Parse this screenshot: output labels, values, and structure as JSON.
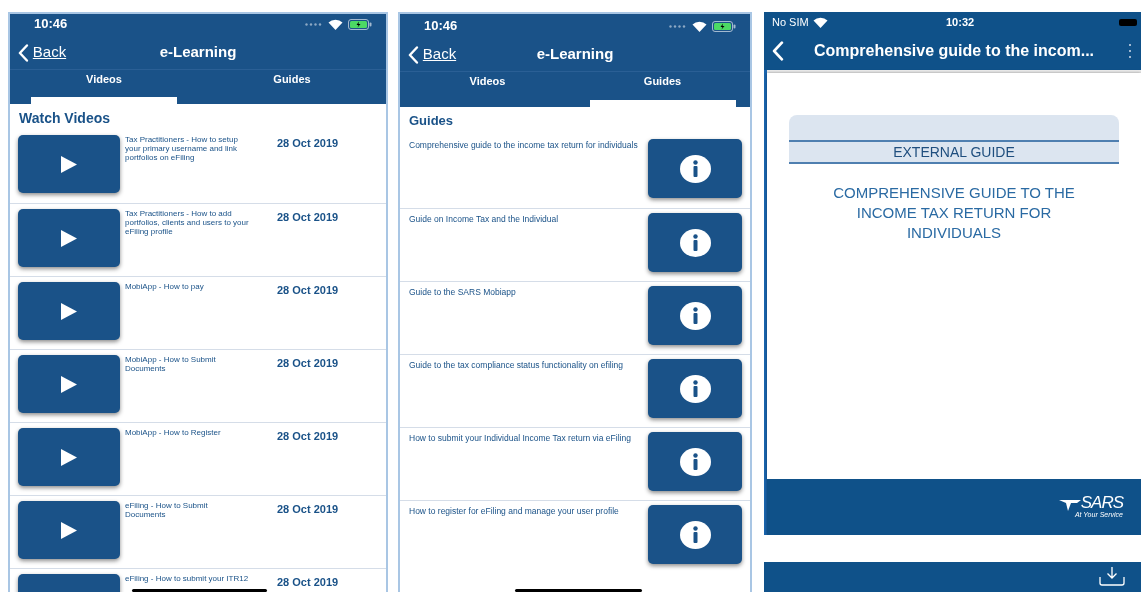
{
  "videos_screen": {
    "status_bar": {
      "time": "10:46"
    },
    "nav": {
      "back": "Back",
      "title": "e-Learning"
    },
    "tabs": [
      {
        "label": "Videos",
        "selected": true
      },
      {
        "label": "Guides",
        "selected": false
      }
    ],
    "heading": "Watch Videos",
    "videos": [
      {
        "title": "Tax Practitioners - How to setup your primary username and link portfolios on eFiling",
        "date": "28 Oct 2019"
      },
      {
        "title": "Tax Practitioners - How to add portfolios, clients and users to your eFiling profile",
        "date": "28 Oct 2019"
      },
      {
        "title": "MobiApp - How to pay",
        "date": "28 Oct 2019"
      },
      {
        "title": "MobiApp - How to Submit Documents",
        "date": "28 Oct 2019"
      },
      {
        "title": "MobiApp - How to Register",
        "date": "28 Oct 2019"
      },
      {
        "title": "eFiling - How to Submit Documents",
        "date": "28 Oct 2019"
      },
      {
        "title": "eFiling - How to submit your ITR12",
        "date": "28 Oct 2019"
      }
    ]
  },
  "guides_screen": {
    "status_bar": {
      "time": "10:46"
    },
    "nav": {
      "back": "Back",
      "title": "e-Learning"
    },
    "tabs": [
      {
        "label": "Videos",
        "selected": false
      },
      {
        "label": "Guides",
        "selected": true
      }
    ],
    "heading": "Guides",
    "guides": [
      {
        "title": "Comprehensive guide to the income tax return for individuals"
      },
      {
        "title": "Guide on Income Tax and the Individual"
      },
      {
        "title": "Guide to the SARS Mobiapp"
      },
      {
        "title": "Guide to the tax compliance status functionality on efiling"
      },
      {
        "title": "How to submit your Individual Income Tax return via eFiling"
      },
      {
        "title": "How to register for eFiling and manage your user profile"
      }
    ]
  },
  "document_screen": {
    "status_bar": {
      "carrier": "No SIM",
      "time": "10:32"
    },
    "nav": {
      "title": "Comprehensive guide to the incom..."
    },
    "document": {
      "banner": "EXTERNAL GUIDE",
      "title": "COMPREHENSIVE GUIDE TO THE INCOME TAX RETURN FOR INDIVIDUALS",
      "logo_name": "SARS",
      "logo_tagline": "At Your Service"
    }
  }
}
